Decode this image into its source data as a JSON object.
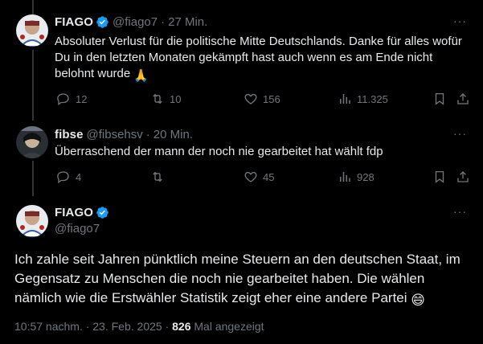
{
  "tweets": [
    {
      "name": "FIAGO",
      "handle": "@fiago7",
      "time": "27 Min.",
      "text": "Absoluter Verlust für die politische Mitte Deutschlands. Danke für alles wofür Du in den letzten Monaten gekämpft hast auch wenn es am Ende nicht belohnt wurde",
      "emoji": "🙏",
      "replies": "12",
      "reposts": "10",
      "likes": "156",
      "views": "11.325"
    },
    {
      "name": "fibse",
      "handle": "@fibsehsv",
      "time": "20 Min.",
      "text": "Überraschend der mann der noch nie gearbeitet hat wählt fdp",
      "replies": "4",
      "reposts": "",
      "likes": "45",
      "views": "928"
    }
  ],
  "main": {
    "name": "FIAGO",
    "handle": "@fiago7",
    "text": "Ich zahle seit Jahren pünktlich meine Steuern an den deutschen Staat, im Gegensatz zu Menschen die noch nie gearbeitet haben. Die wählen nämlich wie die Erstwähler Statistik zeigt eher eine andere Partei",
    "emoji": "😄",
    "timestamp": "10:57 nachm. · 23. Feb. 2025 ·",
    "views_count": "826",
    "views_label": "Mal angezeigt"
  },
  "more_glyph": "···",
  "separator": "·",
  "colors": {
    "background": "#000000",
    "text": "#e7e9ea",
    "muted": "#71767b",
    "verified": "#1d9bf0",
    "thread_line": "#333639"
  },
  "icons": [
    "verified-badge-icon",
    "reply-icon",
    "repost-icon",
    "like-icon",
    "views-icon",
    "bookmark-icon",
    "share-icon",
    "more-icon"
  ]
}
